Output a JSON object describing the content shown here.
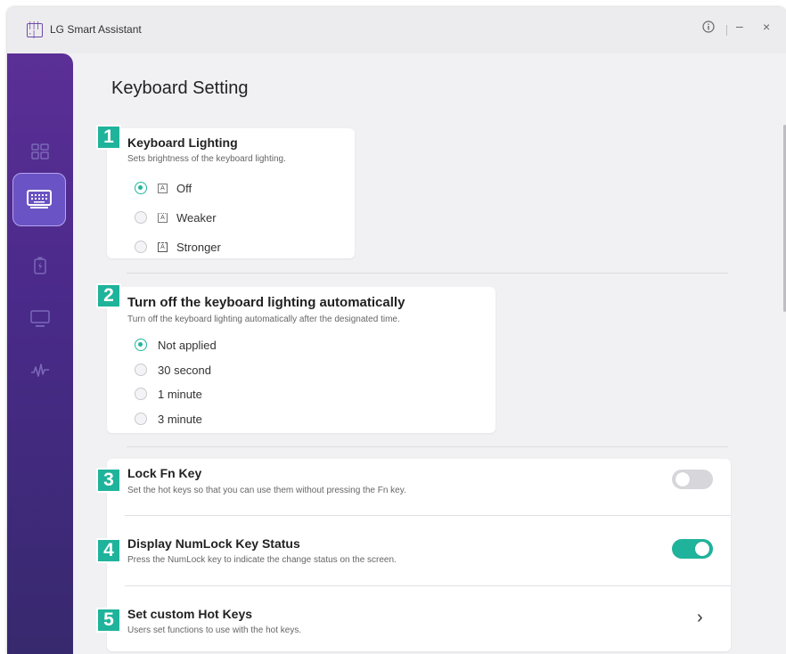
{
  "app": {
    "title": "LG Smart Assistant",
    "logo_text": "|||·|"
  },
  "titlebar": {
    "info_icon": "info-icon",
    "min_label": "–",
    "close_label": "×"
  },
  "sidebar": {
    "items": [
      {
        "icon": "dashboard-icon"
      },
      {
        "icon": "keyboard-icon",
        "active": true
      },
      {
        "icon": "battery-icon"
      },
      {
        "icon": "monitor-icon"
      },
      {
        "icon": "audio-icon"
      }
    ]
  },
  "page_title": "Keyboard Setting",
  "keyboard_lighting": {
    "badge": "1",
    "title": "Keyboard Lighting",
    "description": "Sets brightness of the keyboard lighting.",
    "options": [
      {
        "label": "Off",
        "selected": true
      },
      {
        "label": "Weaker",
        "selected": false
      },
      {
        "label": "Stronger",
        "selected": false
      }
    ]
  },
  "auto_off": {
    "badge": "2",
    "title": "Turn off the keyboard lighting automatically",
    "description": "Turn off the keyboard lighting automatically after the designated time.",
    "options": [
      {
        "label": "Not applied",
        "selected": true
      },
      {
        "label": "30 second",
        "selected": false
      },
      {
        "label": "1 minute",
        "selected": false
      },
      {
        "label": "3 minute",
        "selected": false
      }
    ]
  },
  "lock_fn": {
    "badge": "3",
    "title": "Lock Fn Key",
    "description": "Set the hot keys so that you can use them without pressing the Fn key.",
    "enabled": false
  },
  "numlock": {
    "badge": "4",
    "title": "Display NumLock Key Status",
    "description": "Press the NumLock key to indicate the change status on the screen.",
    "enabled": true
  },
  "hotkeys": {
    "badge": "5",
    "title": "Set custom Hot Keys",
    "description": "Users set functions to use with the hot keys.",
    "chevron": "›"
  },
  "colors": {
    "accent": "#1fb39b",
    "sidebar": "#4a2a8a",
    "active_nav": "#6a53c4"
  }
}
